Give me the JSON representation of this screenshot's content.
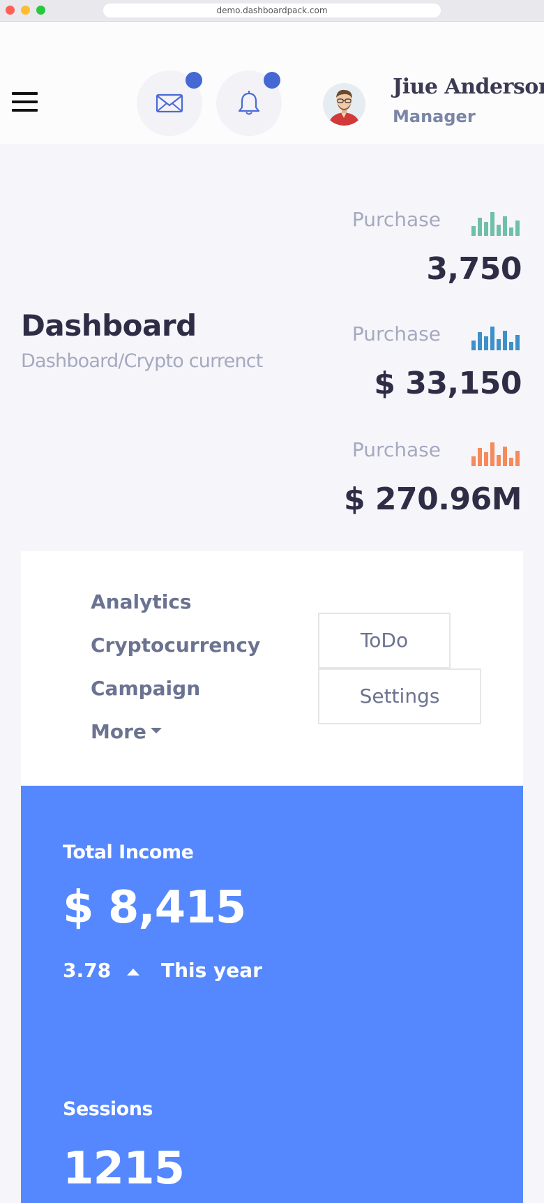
{
  "browser": {
    "url": "demo.dashboardpack.com"
  },
  "header": {
    "user": {
      "name": "Jiue Anderson",
      "role": "Manager"
    },
    "accent": "#4569d4"
  },
  "page": {
    "title": "Dashboard",
    "breadcrumb": "Dashboard/Crypto currenct"
  },
  "stats": [
    {
      "label": "Purchase",
      "value": "3,750",
      "color": "#6fbfa9"
    },
    {
      "label": "Purchase",
      "value": "$ 33,150",
      "color": "#3e90c9"
    },
    {
      "label": "Purchase",
      "value": "$ 270.96M",
      "color": "#f78a5a"
    }
  ],
  "menu": {
    "items": [
      "Analytics",
      "Cryptocurrency",
      "Campaign",
      "More"
    ],
    "tabs": [
      "ToDo",
      "Settings"
    ]
  },
  "income": {
    "label": "Total Income",
    "value": "$ 8,415",
    "change": "3.78",
    "period": "This year",
    "background": "#5588fe"
  },
  "sessions": {
    "label": "Sessions",
    "value": "1215"
  }
}
